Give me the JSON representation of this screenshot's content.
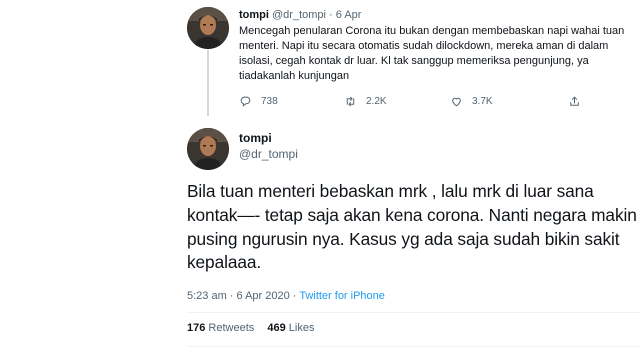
{
  "parent_tweet": {
    "name": "tompi",
    "handle": "@dr_tompi",
    "separator": "·",
    "date": "6 Apr",
    "text": "Mencegah penularan Corona itu bukan dengan membebaskan napi wahai tuan menteri. Napi itu secara otomatis sudah dilockdown, mereka aman di dalam isolasi, cegah kontak dr luar. Kl tak sanggup memeriksa pengunjung, ya tiadakanlah kunjungan",
    "actions": {
      "reply_icon": "reply-icon",
      "reply_count": "738",
      "retweet_icon": "retweet-icon",
      "retweet_count": "2.2K",
      "like_icon": "heart-icon",
      "like_count": "3.7K",
      "share_icon": "share-icon"
    }
  },
  "main_tweet": {
    "name": "tompi",
    "handle": "@dr_tompi",
    "text": "Bila tuan menteri bebaskan mrk , lalu mrk di luar sana kontak—- tetap saja akan kena corona. Nanti negara makin pusing ngurusin nya.  Kasus yg ada saja sudah bikin sakit kepalaaa.",
    "timestamp": "5:23 am · 6 Apr 2020 · ",
    "source": "Twitter for iPhone",
    "retweets_count": "176",
    "retweets_label": "Retweets",
    "likes_count": "469",
    "likes_label": "Likes"
  },
  "colors": {
    "text": "#0f1419",
    "secondary": "#536471",
    "accent": "#1d9bf0",
    "thread_line": "#cfd9de"
  }
}
